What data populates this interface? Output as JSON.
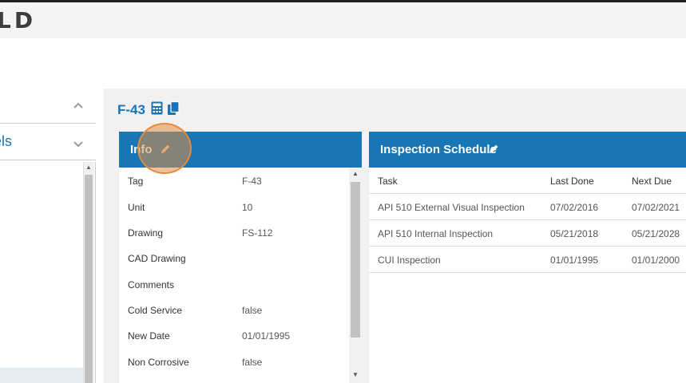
{
  "app": {
    "logo_text": "LD"
  },
  "sidebar": {
    "visible_label": "els"
  },
  "asset": {
    "title": "F-43"
  },
  "info": {
    "title": "Info",
    "rows": [
      {
        "key": "Tag",
        "value": "F-43"
      },
      {
        "key": "Unit",
        "value": "10"
      },
      {
        "key": "Drawing",
        "value": "FS-112"
      },
      {
        "key": "CAD Drawing",
        "value": ""
      },
      {
        "key": "Comments",
        "value": ""
      },
      {
        "key": "Cold Service",
        "value": "false"
      },
      {
        "key": "New Date",
        "value": "01/01/1995"
      },
      {
        "key": "Non Corrosive",
        "value": "false"
      }
    ]
  },
  "schedule": {
    "title": "Inspection Schedule",
    "columns": [
      "Task",
      "Last Done",
      "Next Due"
    ],
    "rows": [
      [
        "API 510 External Visual Inspection",
        "07/02/2016",
        "07/02/2021"
      ],
      [
        "API 510 Internal Inspection",
        "05/21/2018",
        "05/21/2028"
      ],
      [
        "CUI Inspection",
        "01/01/1995",
        "01/01/2000"
      ]
    ]
  },
  "icons": {
    "chevron_up": "chevron-up-icon",
    "chevron_down": "chevron-down-icon",
    "calculator": "calculator-icon",
    "copy": "copy-icon",
    "edit": "pencil-icon"
  },
  "colors": {
    "accent": "#1776b3",
    "title_blue": "#1a73b5",
    "cursor": "#e68a3c"
  }
}
